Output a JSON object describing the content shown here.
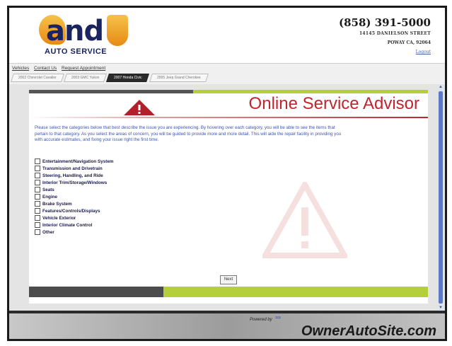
{
  "header": {
    "brand_text": "and",
    "tagline": "AUTO SERVICE",
    "phone": "(858) 391-5000",
    "address_line": "14145 DANIELSON STREET",
    "city_line": "POWAY CA, 92064",
    "login_label": "Logout"
  },
  "nav": {
    "menu": [
      "Vehicles",
      "Contact Us",
      "Request Appointment"
    ],
    "tabs": [
      "2002 Chevrolet Cavalier",
      "2003 GMC Yukon",
      "2007 Honda Civic",
      "2005 Jeep Grand Cherokee"
    ],
    "active_tab_index": 2
  },
  "main": {
    "title": "Online Service Advisor",
    "intro": "Please select the categories below that best describe the issue you are experiencing. By hovering over each category, you will be able to see the items that pertain to that category. As you select the areas of concern, you will be guided to provide more and more detail. This will aide the repair facility in providing you with accurate estimates, and fixing your issue right the first time.",
    "categories": [
      "Entertainment/Navigation System",
      "Transmission and Drivetrain",
      "Steering, Handling, and Ride",
      "Interior Trim/Storage/Windows",
      "Seats",
      "Engine",
      "Brake System",
      "Features/Controls/Displays",
      "Vehicle Exterior",
      "Interior Climate Control",
      "Other"
    ],
    "next_label": "Next"
  },
  "footer": {
    "powered_label": "Powered by",
    "site": "OwnerAutoSite.com"
  },
  "colors": {
    "title_red": "#c0262e",
    "intro_blue": "#3c55b5",
    "accent_green": "#b5cf3a",
    "brand_navy": "#1a2460",
    "brand_orange": "#e78a15"
  }
}
